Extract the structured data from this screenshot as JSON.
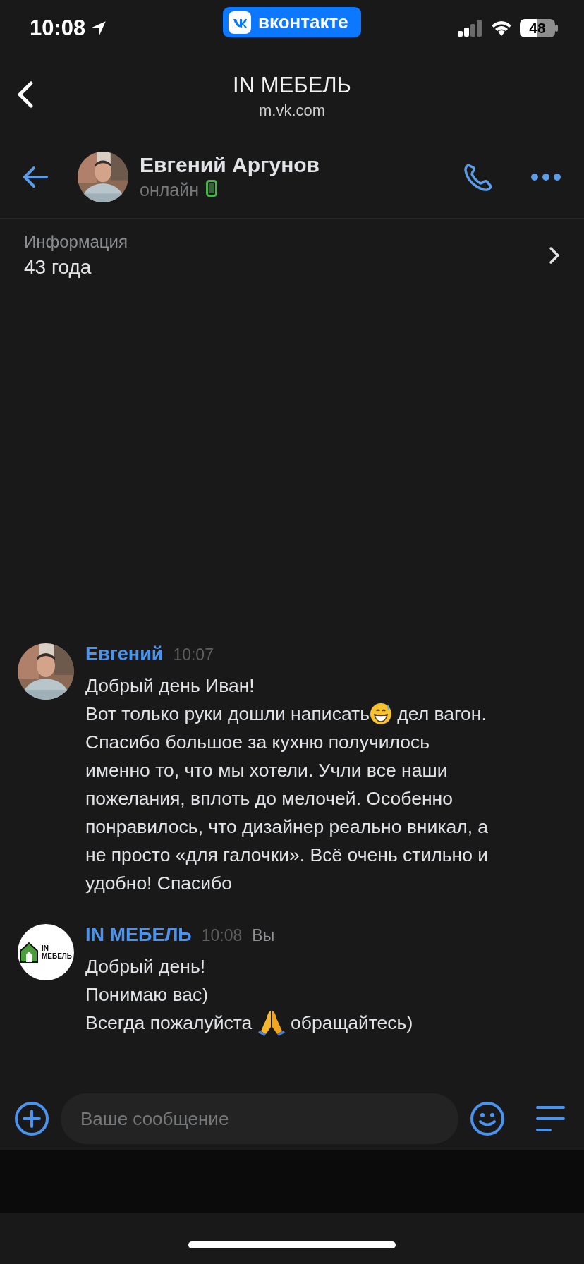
{
  "status_bar": {
    "time": "10:08",
    "app_badge": "вконтакте",
    "battery": "48"
  },
  "browser_bar": {
    "title": "IN МЕБЕЛЬ",
    "url": "m.vk.com"
  },
  "chat_header": {
    "name": "Евгений Аргунов",
    "status": "онлайн",
    "mobile": true
  },
  "info": {
    "label": "Информация",
    "value": "43 года"
  },
  "messages": [
    {
      "author": "Евгений",
      "time": "10:07",
      "blocks": [
        {
          "kind": "text",
          "text": "Добрый день Иван!"
        },
        {
          "kind": "line",
          "parts": [
            {
              "kind": "text",
              "text": "Вот только руки дошли написать"
            },
            {
              "kind": "smile"
            },
            {
              "kind": "text",
              "text": " дел вагон."
            }
          ]
        },
        {
          "kind": "text",
          "text": "Спасибо большое за кухню получилось\nименно то, что мы хотели. Учли все наши\nпожелания, вплоть до мелочей. Особенно\nпонравилось, что дизайнер реально вникал, а\nне просто «для галочки». Всё очень стильно и\nудобно! Спасибо"
        }
      ]
    },
    {
      "author": "IN МЕБЕЛЬ",
      "time": "10:08",
      "own_label": "Вы",
      "avatar": {
        "kind": "logo",
        "text": [
          "IN",
          "МЕБЕЛЬ"
        ]
      },
      "blocks": [
        {
          "kind": "text",
          "text": "Добрый день!\nПонимаю вас)"
        },
        {
          "kind": "line",
          "parts": [
            {
              "kind": "text",
              "text": "Всегда пожалуйста "
            },
            {
              "kind": "pray"
            },
            {
              "kind": "text",
              "text": " обращайтесь)"
            }
          ]
        }
      ]
    }
  ],
  "composer": {
    "placeholder": "Ваше сообщение"
  }
}
